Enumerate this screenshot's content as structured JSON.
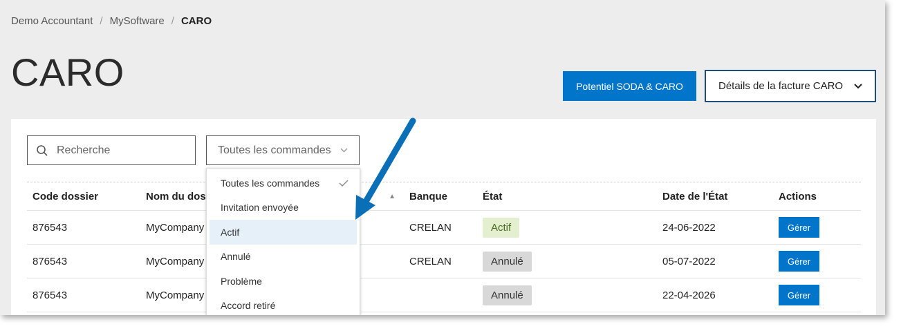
{
  "breadcrumb": [
    "Demo Accountant",
    "MySoftware",
    "CARO"
  ],
  "page_title": "CARO",
  "actions": {
    "primary_label": "Potentiel SODA & CARO",
    "details_label": "Détails de la facture CARO"
  },
  "search": {
    "placeholder": "Recherche"
  },
  "filter": {
    "selected": "Toutes les commandes"
  },
  "table": {
    "headers": [
      "Code dossier",
      "Nom du dossier",
      "Banque",
      "État",
      "Date de l'État",
      "Actions"
    ],
    "rows": [
      {
        "code": "876543",
        "name": "MyCompany",
        "bank": "CRELAN",
        "state": "Actif",
        "date": "24-06-2022",
        "action": "Gérer"
      },
      {
        "code": "876543",
        "name": "MyCompany",
        "bank": "CRELAN",
        "state": "Annulé",
        "date": "05-07-2022",
        "action": "Gérer"
      },
      {
        "code": "876543",
        "name": "MyCompany",
        "bank": "",
        "state": "Annulé",
        "date": "22-04-2026",
        "action": "Gérer"
      }
    ]
  },
  "dropdown": {
    "options": [
      "Toutes les commandes",
      "Invitation envoyée",
      "Actif",
      "Annulé",
      "Problème",
      "Accord retiré"
    ],
    "checked_index": 0,
    "highlighted_index": 2
  },
  "colors": {
    "accent": "#0075c9",
    "arrow": "#0b6fb8"
  }
}
